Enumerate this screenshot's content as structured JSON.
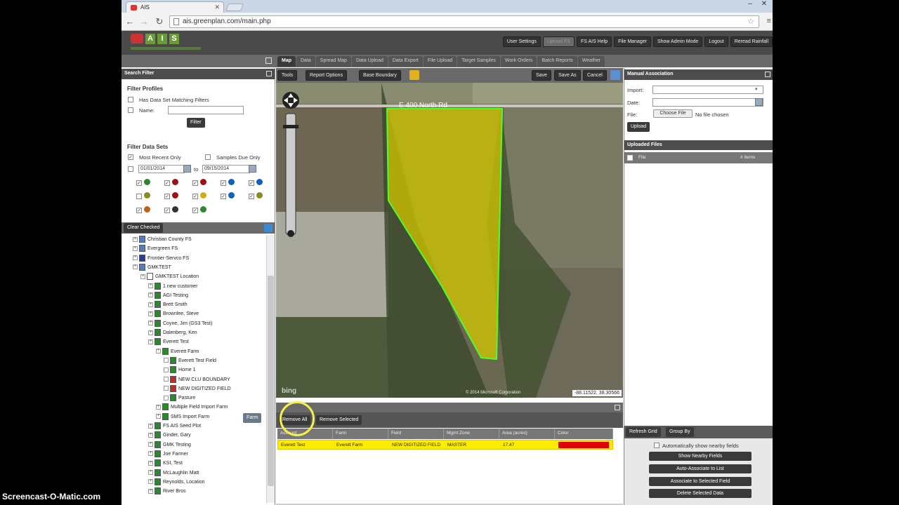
{
  "browser": {
    "tab_title": "AIS",
    "url": "ais.greenplan.com/main.php"
  },
  "app": {
    "logo_letters": [
      "A",
      "I",
      "S"
    ],
    "header_buttons": [
      "User Settings",
      "Upload FS",
      "FS AIS Help",
      "File Manager",
      "Show Admin Mode",
      "Logout",
      "Reread Rainfall"
    ]
  },
  "main_tabs": [
    "Map",
    "Data",
    "Spread Map",
    "Data Upload",
    "Data Export",
    "File Upload",
    "Target Samples",
    "Work Orders",
    "Batch Reports",
    "Weather"
  ],
  "search_filter": {
    "title": "Search Filter",
    "profiles_heading": "Filter Profiles",
    "has_data_set": "Has Data Set Matching Filters",
    "name_label": "Name:",
    "filter_button": "Filter",
    "datasets_heading": "Filter Data Sets",
    "most_recent": "Most Recent Only",
    "samples_due": "Samples Due Only",
    "date_from": "01/01/2014",
    "date_to_label": "to",
    "date_to": "09/15/2014"
  },
  "tree": {
    "clear_checked": "Clear Checked",
    "farm_badge": "Farm",
    "items": [
      {
        "label": "Christian County FS",
        "indent": 0
      },
      {
        "label": "Evergreen FS",
        "indent": 0
      },
      {
        "label": "Frontier-Servco FS",
        "indent": 0
      },
      {
        "label": "GMKTEST",
        "indent": 0
      },
      {
        "label": "GMKTEST Location",
        "indent": 1
      },
      {
        "label": "1 new customer",
        "indent": 2
      },
      {
        "label": "AGI Testing",
        "indent": 2
      },
      {
        "label": "Brett Smith",
        "indent": 2
      },
      {
        "label": "Brownlee, Steve",
        "indent": 2
      },
      {
        "label": "Coyne, Jim (GS3 Test)",
        "indent": 2
      },
      {
        "label": "Dalenberg, Ken",
        "indent": 2
      },
      {
        "label": "Everett Test",
        "indent": 2
      },
      {
        "label": "Everett Farm",
        "indent": 3
      },
      {
        "label": "Everett Test Field",
        "indent": 4
      },
      {
        "label": "Home 1",
        "indent": 4
      },
      {
        "label": "NEW CLU BOUNDARY",
        "indent": 4
      },
      {
        "label": "NEW DIGITIZED FIELD",
        "indent": 4
      },
      {
        "label": "Pasture",
        "indent": 4
      },
      {
        "label": "Multiple Field Import Farm",
        "indent": 3
      },
      {
        "label": "SMS Import Farm",
        "indent": 3
      },
      {
        "label": "FS AIS Seed Plot",
        "indent": 2
      },
      {
        "label": "Ginder, Gary",
        "indent": 2
      },
      {
        "label": "GMK Testing",
        "indent": 2
      },
      {
        "label": "Joe Farmer",
        "indent": 2
      },
      {
        "label": "KSI, Test",
        "indent": 2
      },
      {
        "label": "McLaughlin Matt",
        "indent": 2
      },
      {
        "label": "Reynolds, Location",
        "indent": 2
      },
      {
        "label": "River Bros",
        "indent": 2
      }
    ]
  },
  "map": {
    "toolbar": {
      "tools": "Tools",
      "report_options": "Report Options",
      "base_boundary": "Base Boundary",
      "save": "Save",
      "save_as": "Save As",
      "cancel": "Cancel"
    },
    "road_label": "E 400 North Rd",
    "coordinates": "-88.11522, 38.30566",
    "copyright": "© 2014 Microsoft Corporation",
    "bing": "bing"
  },
  "grid": {
    "remove_all": "Remove All",
    "remove_selected": "Remove Selected",
    "columns": [
      "Account",
      "Farm",
      "Field",
      "Mgmt Zone",
      "Area (acres)",
      "Color"
    ],
    "rows": [
      {
        "account": "Everett Test",
        "farm": "Everett Farm",
        "field": "NEW DIGITIZED FIELD",
        "zone": "MASTER",
        "area": "17.47",
        "color": "#e00000"
      }
    ]
  },
  "manual_association": {
    "title": "Manual Association",
    "import_label": "Import:",
    "date_label": "Date:",
    "file_label": "File:",
    "choose_file": "Choose File",
    "no_file": "No file chosen",
    "upload": "Upload"
  },
  "uploaded_files": {
    "title": "Uploaded Files",
    "col_file": "File",
    "col_items": "# Items"
  },
  "right_bottom": {
    "refresh_grid": "Refresh Grid",
    "group_by": "Group By",
    "auto_show": "Automatically show nearby fields",
    "buttons": [
      "Show Nearby Fields",
      "Auto-Associate to List",
      "Associate to Selected Field",
      "Delete Selected Data"
    ]
  },
  "watermark": "Screencast-O-Matic.com"
}
